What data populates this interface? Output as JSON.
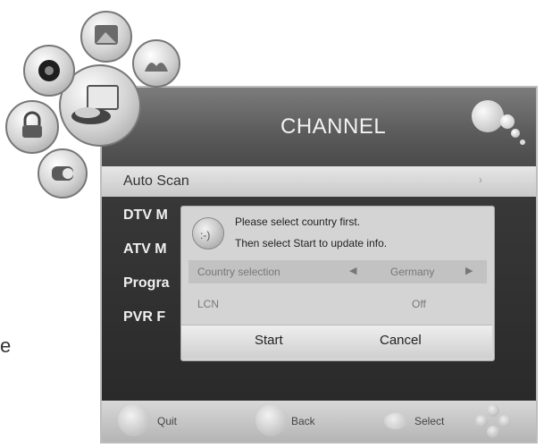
{
  "edge_letter": "e",
  "menu": {
    "title": "CHANNEL",
    "items": [
      {
        "label": "Auto Scan",
        "selected": true
      },
      {
        "label": "DTV M"
      },
      {
        "label": "ATV M"
      },
      {
        "label": "Progra"
      },
      {
        "label": "PVR F"
      }
    ]
  },
  "dialog": {
    "message_line1": "Please select country first.",
    "message_line2": "Then select Start to update info.",
    "country_label": "Country selection",
    "country_value": "Germany",
    "lcn_label": "LCN",
    "lcn_value": "Off",
    "start_label": "Start",
    "cancel_label": "Cancel"
  },
  "footer": {
    "quit_label": "Quit",
    "back_label": "Back",
    "select_label": "Select"
  },
  "icons": {
    "left_arrow": "◀",
    "right_arrow": "▶",
    "chevron": "›"
  }
}
